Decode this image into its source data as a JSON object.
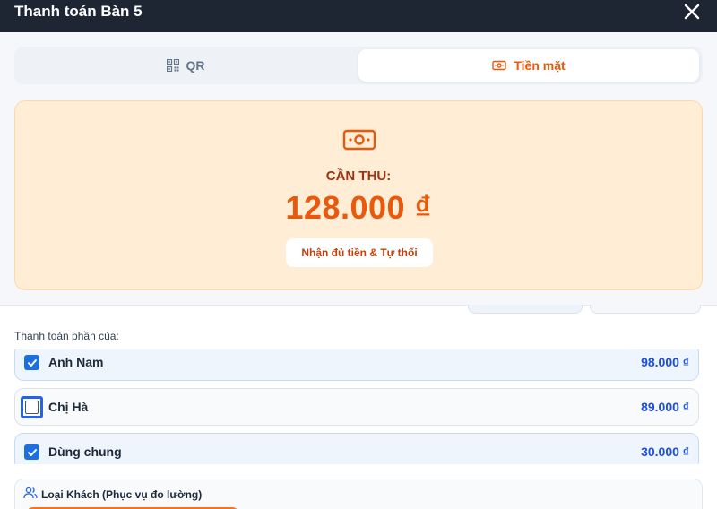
{
  "dialog": {
    "title": "Thanh toán Bàn 5",
    "close_icon": "close-icon"
  },
  "tabs": [
    {
      "label": "QR",
      "icon": "qr-icon",
      "active": false
    },
    {
      "label": "Tiền mặt",
      "icon": "cash-icon",
      "active": true
    }
  ],
  "cash_panel": {
    "icon": "money-icon",
    "need_label": "CẦN THU:",
    "amount": "128.000 ₫",
    "full_button_label": "Nhận đủ tiền & Tự thối"
  },
  "split": {
    "section_label": "Thanh toán phần của:",
    "people": [
      {
        "name": "Anh Nam",
        "amount": "98.000 ₫",
        "checked": true
      },
      {
        "name": "Chị Hà",
        "amount": "89.000 ₫",
        "checked": false
      },
      {
        "name": "Dùng chung",
        "amount": "30.000 ₫",
        "checked": true
      }
    ]
  },
  "customer_type": {
    "icon": "users-icon",
    "label": "Loại Khách (Phục vụ đo lường)"
  },
  "colors": {
    "header_bg": "#1e2633",
    "accent_orange": "#ea580c",
    "card_bg": "#ffedd5",
    "amount_blue": "#1d4ed8",
    "checkbox_blue": "#1d6fe0"
  }
}
